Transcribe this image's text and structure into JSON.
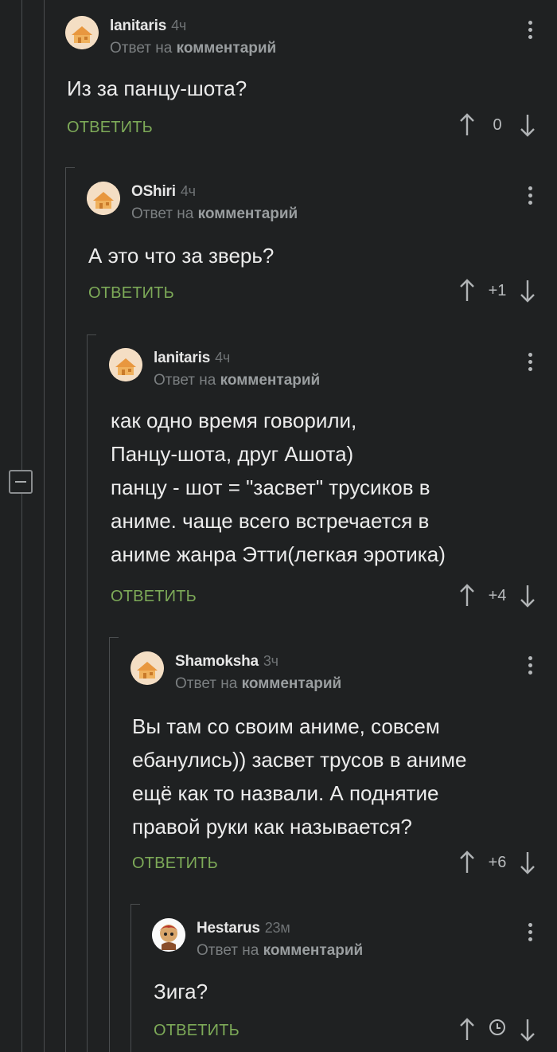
{
  "comments": [
    {
      "author": "lanitaris",
      "time": "4ч",
      "reply_prefix": "Ответ на",
      "reply_link": "комментарий",
      "text": "Из за панцу-шота?",
      "reply_label": "ОТВЕТИТЬ",
      "score": "0",
      "avatar": "pikabu-default-avatar"
    },
    {
      "author": "OShiri",
      "time": "4ч",
      "reply_prefix": "Ответ на",
      "reply_link": "комментарий",
      "text": "А это что за зверь?",
      "reply_label": "ОТВЕТИТЬ",
      "score": "+1",
      "avatar": "pikabu-default-avatar"
    },
    {
      "author": "lanitaris",
      "time": "4ч",
      "reply_prefix": "Ответ на",
      "reply_link": "комментарий",
      "text": "как одно время говорили,\nПанцу-шота, друг Ашота)\nпанцу - шот = \"засвет\" трусиков в\nаниме. чаще всего встречается в\nаниме жанра Этти(легкая эротика)",
      "reply_label": "ОТВЕТИТЬ",
      "score": "+4",
      "avatar": "pikabu-default-avatar"
    },
    {
      "author": "Shamoksha",
      "time": "3ч",
      "reply_prefix": "Ответ на",
      "reply_link": "комментарий",
      "text": "Вы там со своим аниме, совсем\nебанулись)) засвет трусов в аниме\nещё как то назвали. А поднятие\nправой руки как называется?",
      "reply_label": "ОТВЕТИТЬ",
      "score": "+6",
      "avatar": "pikabu-default-avatar"
    },
    {
      "author": "Hestarus",
      "time": "23м",
      "reply_prefix": "Ответ на",
      "reply_link": "комментарий",
      "text": "Зига?",
      "reply_label": "ОТВЕТИТЬ",
      "score_icon": "clock-icon",
      "avatar": "user-photo-avatar"
    }
  ],
  "colors": {
    "background": "#1f2122",
    "reply_button": "#7daa58",
    "muted_text": "#7b7f81",
    "thread_line": "#4a4d4f"
  }
}
